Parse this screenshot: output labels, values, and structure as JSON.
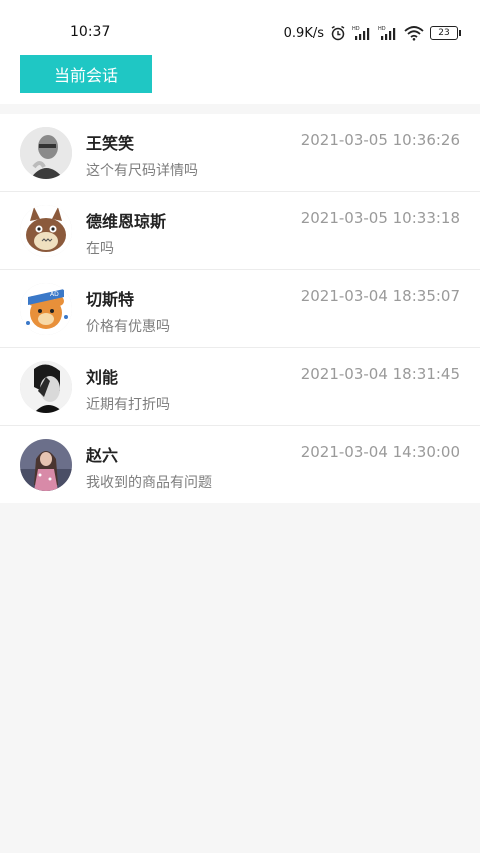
{
  "status_bar": {
    "time": "10:37",
    "net_speed": "0.9K/s",
    "battery": "23",
    "icons": [
      "alarm-icon",
      "hd-signal-icon",
      "hd-signal-icon",
      "wifi-icon",
      "battery-icon"
    ]
  },
  "header": {
    "tab_label": "当前会话",
    "accent_color": "#1fc7c4"
  },
  "conversations": [
    {
      "name": "王笑笑",
      "time": "2021-03-05 10:36:26",
      "message": "这个有尺码详情吗"
    },
    {
      "name": "德维恩琼斯",
      "time": "2021-03-05 10:33:18",
      "message": "在吗"
    },
    {
      "name": "切斯特",
      "time": "2021-03-04 18:35:07",
      "message": "价格有优惠吗"
    },
    {
      "name": "刘能",
      "time": "2021-03-04 18:31:45",
      "message": "近期有打折吗"
    },
    {
      "name": "赵六",
      "time": "2021-03-04 14:30:00",
      "message": "我收到的商品有问题"
    }
  ]
}
